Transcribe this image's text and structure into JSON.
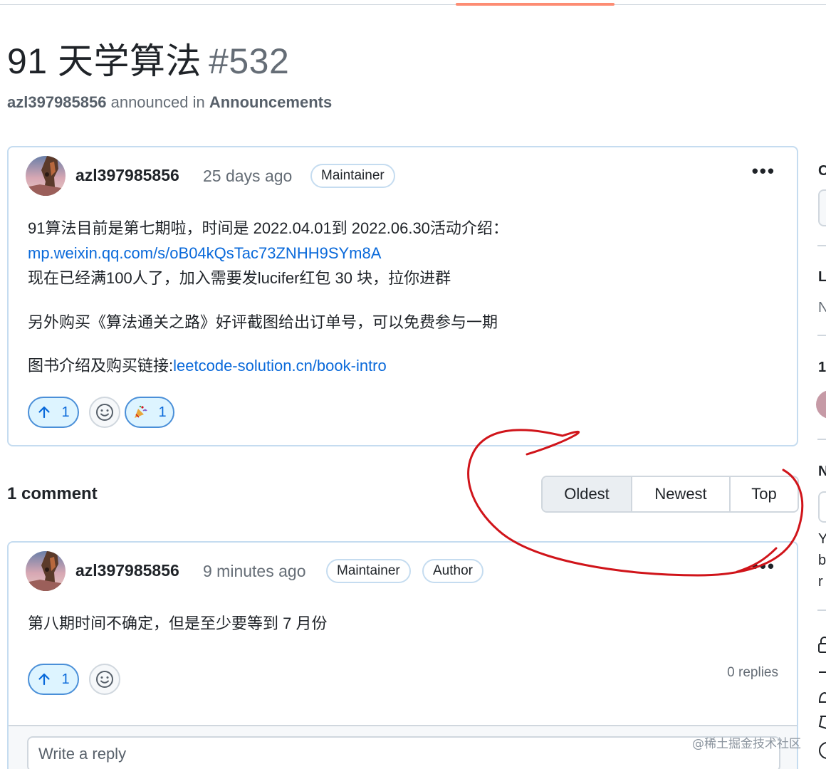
{
  "discussion": {
    "title": "91 天学算法",
    "number": "#532",
    "author": "azl397985856",
    "announced_text": "announced in",
    "category": "Announcements"
  },
  "post": {
    "author": "azl397985856",
    "time": "25 days ago",
    "badge": "Maintainer",
    "line1": "91算法目前是第七期啦，时间是 2022.04.01到 2022.06.30活动介绍：",
    "link1": "mp.weixin.qq.com/s/oB04kQsTac73ZNHH9SYm8A",
    "line2": "现在已经满100人了，加入需要发lucifer红包 30 块，拉你进群",
    "line3": "另外购买《算法通关之路》好评截图给出订单号，可以免费参与一期",
    "line4_prefix": "图书介绍及购买链接:",
    "link2": "leetcode-solution.cn/book-intro",
    "upvote_count": "1",
    "tada_count": "1"
  },
  "comments_header": {
    "count_label": "1 comment",
    "sort": [
      "Oldest",
      "Newest",
      "Top"
    ],
    "active_sort": "Oldest"
  },
  "comment": {
    "author": "azl397985856",
    "time": "9 minutes ago",
    "badges": [
      "Maintainer",
      "Author"
    ],
    "text": "第八期时间不确定，但是至少要等到 7 月份",
    "upvote_count": "1",
    "replies": "0 replies",
    "reply_placeholder": "Write a reply"
  },
  "watermark": "@稀土掘金技术社区",
  "colors": {
    "link": "#0969da",
    "accent_border": "#c5dcf0",
    "tab_underline": "#fd8c73",
    "annotation_red": "#d0141a"
  }
}
